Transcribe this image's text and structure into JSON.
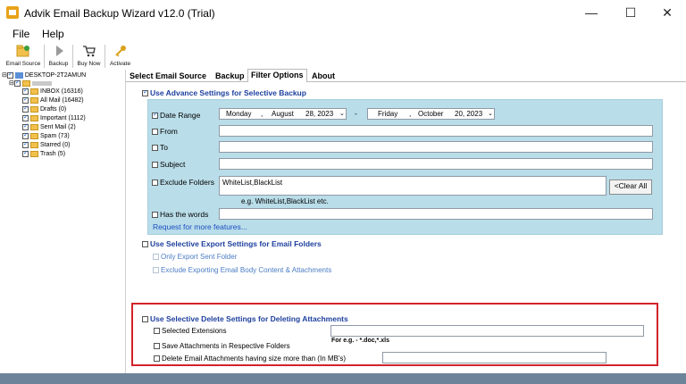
{
  "window": {
    "title": "Advik Email Backup Wizard v12.0 (Trial)",
    "minimize": "—",
    "maximize": "☐",
    "close": "✕"
  },
  "menu": [
    "File",
    "Help"
  ],
  "toolbar": [
    {
      "label": "Email Source",
      "icon": "folder-add-icon"
    },
    {
      "label": "Backup",
      "icon": "play-icon"
    },
    {
      "label": "Buy Now",
      "icon": "cart-icon"
    },
    {
      "label": "Activate",
      "icon": "key-icon"
    }
  ],
  "tree": {
    "root": "DESKTOP-2T2AMUN",
    "items": [
      {
        "label": "INBOX (16316)"
      },
      {
        "label": "All Mail (16482)"
      },
      {
        "label": "Drafts (0)"
      },
      {
        "label": "Important (1112)"
      },
      {
        "label": "Sent Mail (2)"
      },
      {
        "label": "Spam (73)"
      },
      {
        "label": "Starred (0)"
      },
      {
        "label": "Trash (5)"
      }
    ]
  },
  "tabs": [
    "Select Email Source",
    "Backup",
    "Filter Options",
    "About"
  ],
  "advance": {
    "heading": "Use Advance Settings for Selective Backup",
    "date_range_label": "Date Range",
    "start_date": {
      "day": "Monday",
      "sep": ",",
      "month": "August",
      "date": "28, 2023"
    },
    "date_dash": "-",
    "end_date": {
      "day": "Friday",
      "sep": ",",
      "month": "October",
      "date": "20, 2023"
    },
    "from_label": "From",
    "to_label": "To",
    "subject_label": "Subject",
    "exclude_label": "Exclude Folders",
    "exclude_value": "WhiteList,BlackList",
    "exclude_hint": "e.g. WhiteList,BlackList etc.",
    "clear_all": "<Clear All",
    "has_words_label": "Has the words",
    "more_link": "Request for more features..."
  },
  "export": {
    "heading": "Use Selective Export Settings for Email Folders",
    "only_sent": "Only Export Sent Folder",
    "exclude_body": "Exclude Exporting Email Body Content & Attachments"
  },
  "delete": {
    "heading": "Use Selective Delete Settings for Deleting Attachments",
    "selected_ext": "Selected Extensions",
    "ext_hint": "For e.g. - *.doc,*.xls",
    "save_attach": "Save Attachments in Respective Folders",
    "delete_size": "Delete Email Attachments having size more than (In MB's)"
  },
  "colors": {
    "panel": "#b9dde9",
    "heading_blue": "#1d3f9e",
    "highlight_red": "#d2232a",
    "status_bar": "#6d8399"
  }
}
